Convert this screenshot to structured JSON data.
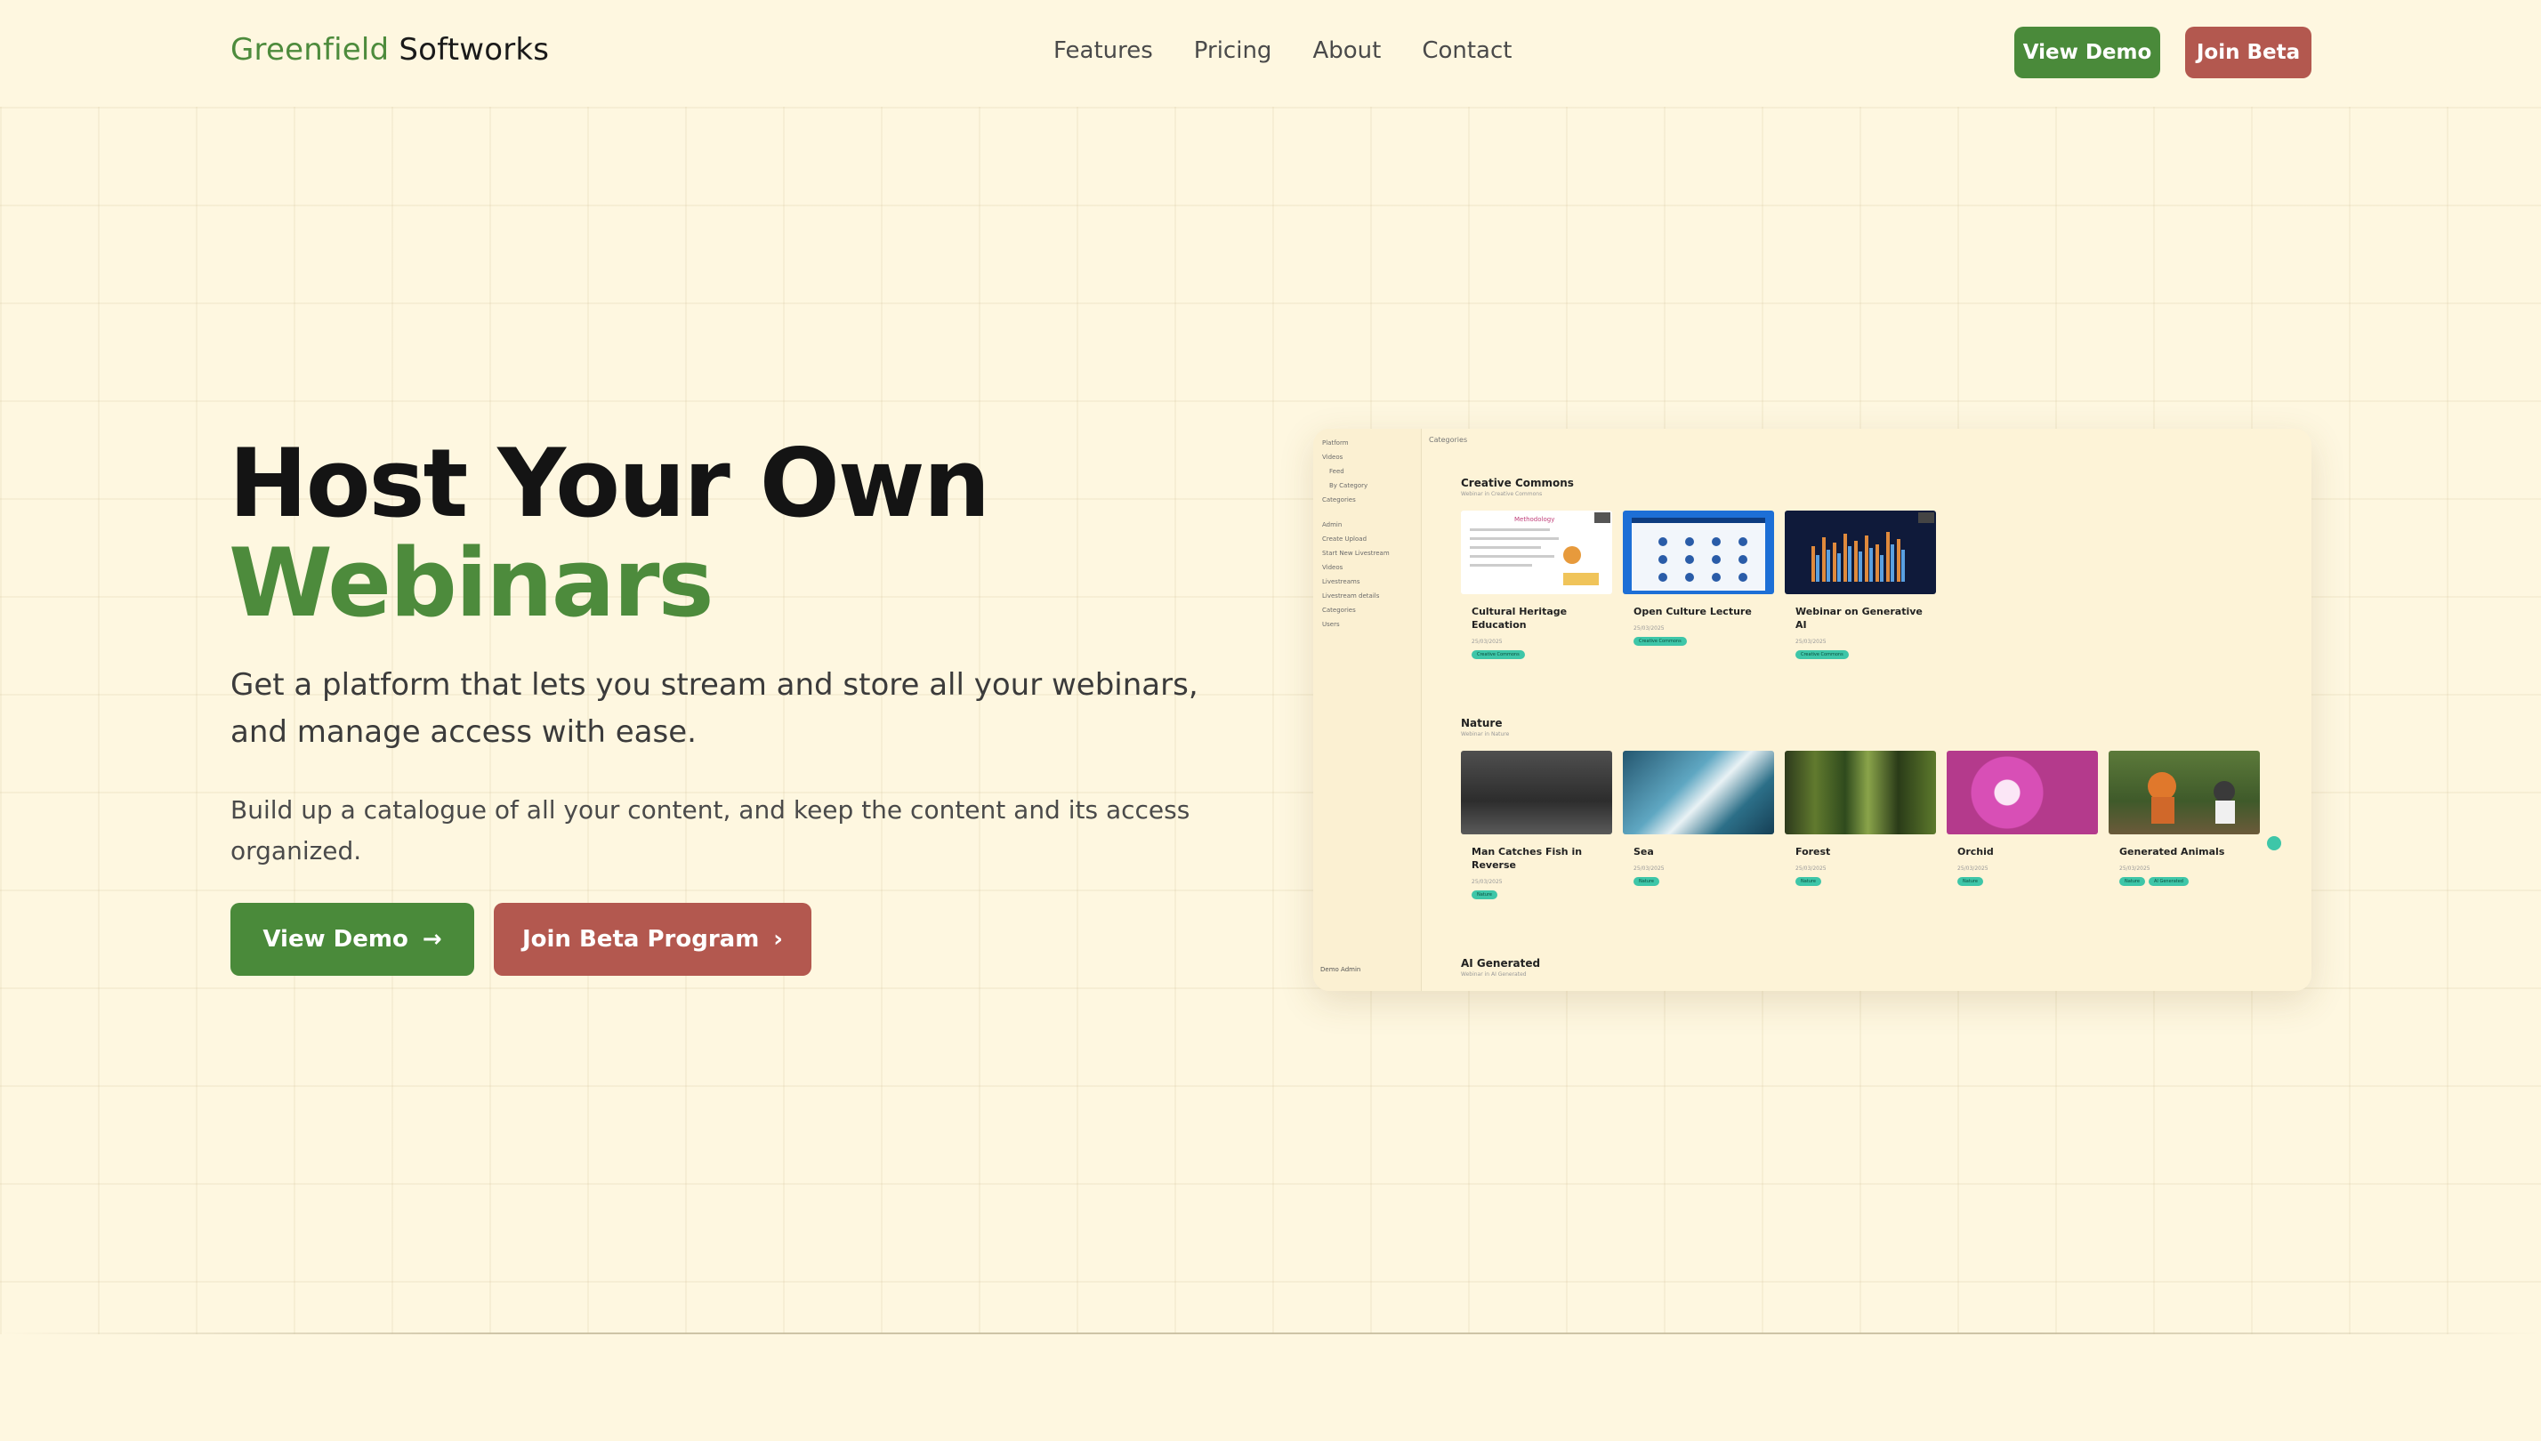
{
  "brand": {
    "part1": "Greenfield",
    "part2": "Softworks"
  },
  "nav": {
    "links": [
      "Features",
      "Pricing",
      "About",
      "Contact"
    ]
  },
  "header_buttons": {
    "demo": "View Demo",
    "beta": "Join Beta"
  },
  "hero": {
    "title_line1": "Host Your Own",
    "title_line2": "Webinars",
    "lead": "Get a platform that lets you stream and store all your webinars, and manage access with ease.",
    "sub": "Build up a catalogue of all your content, and keep the content and its access organized.",
    "cta_demo": "View Demo",
    "cta_beta": "Join Beta Program",
    "cta_demo_icon": "→",
    "cta_beta_icon": "›"
  },
  "colors": {
    "green": "#4a8a3a",
    "red": "#b3584f",
    "bg": "#fef7e0",
    "tag": "#3ec6a8"
  },
  "mockup": {
    "topbar": "Categories",
    "sidebar": {
      "items": [
        "Platform",
        "Videos",
        "Feed",
        "By Category",
        "Categories",
        "Admin",
        "Create Upload",
        "Start New Livestream",
        "Videos",
        "Livestreams",
        "Livestream details",
        "Categories",
        "Users"
      ],
      "user": "Demo Admin"
    },
    "sections": [
      {
        "title": "Creative Commons",
        "subtitle": "Webinar in Creative Commons",
        "cards": [
          {
            "title": "Cultural Heritage Education",
            "date": "25/03/2025",
            "tags": [
              "Creative Commons"
            ]
          },
          {
            "title": "Open Culture Lecture",
            "date": "25/03/2025",
            "tags": [
              "Creative Commons"
            ]
          },
          {
            "title": "Webinar on Generative AI",
            "date": "25/03/2025",
            "tags": [
              "Creative Commons"
            ]
          }
        ]
      },
      {
        "title": "Nature",
        "subtitle": "Webinar in Nature",
        "cards": [
          {
            "title": "Man Catches Fish in Reverse",
            "date": "25/03/2025",
            "tags": [
              "Nature"
            ]
          },
          {
            "title": "Sea",
            "date": "25/03/2025",
            "tags": [
              "Nature"
            ]
          },
          {
            "title": "Forest",
            "date": "25/03/2025",
            "tags": [
              "Nature"
            ]
          },
          {
            "title": "Orchid",
            "date": "25/03/2025",
            "tags": [
              "Nature"
            ]
          },
          {
            "title": "Generated Animals",
            "date": "25/03/2025",
            "tags": [
              "Nature",
              "AI Generated"
            ]
          }
        ]
      },
      {
        "title": "AI Generated",
        "subtitle": "Webinar in AI Generated"
      }
    ]
  }
}
